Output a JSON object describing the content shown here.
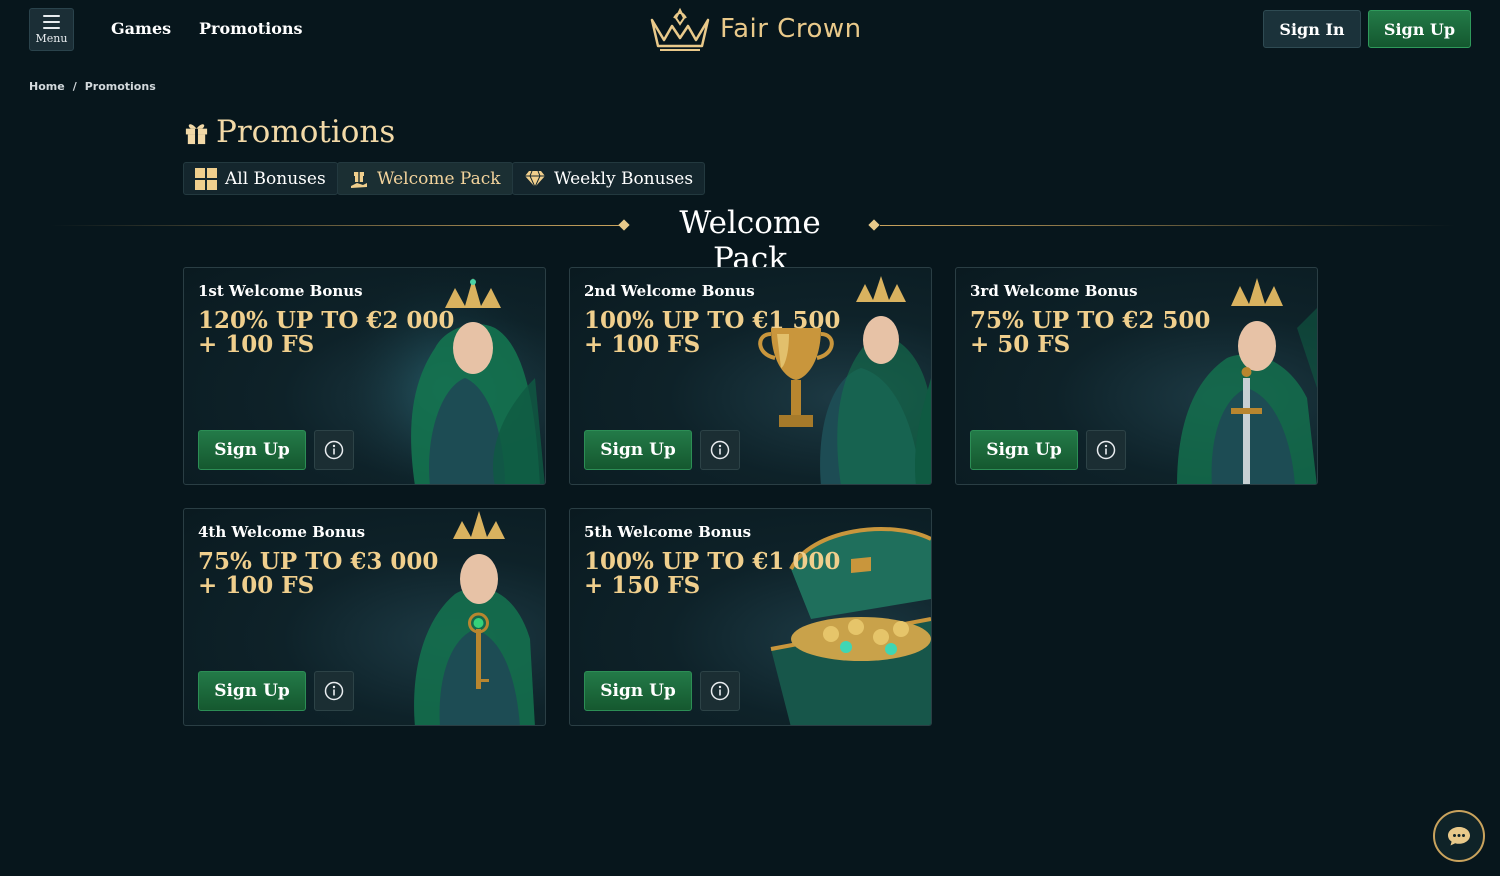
{
  "header": {
    "menu_label": "Menu",
    "nav": [
      "Games",
      "Promotions"
    ],
    "logo_text": "Fair Crown",
    "sign_in": "Sign In",
    "sign_up": "Sign Up"
  },
  "breadcrumb": {
    "home": "Home",
    "separator": "/",
    "current": "Promotions"
  },
  "page_title": "Promotions",
  "tabs": [
    {
      "label": "All Bonuses",
      "icon": "grid-icon",
      "active": false
    },
    {
      "label": "Welcome Pack",
      "icon": "gift-hand-icon",
      "active": true
    },
    {
      "label": "Weekly Bonuses",
      "icon": "diamond-icon",
      "active": false
    }
  ],
  "section_title": "Welcome Pack",
  "cards": [
    {
      "title": "1st Welcome Bonus",
      "amount": "120% UP TO €2 000",
      "spins": "+ 100 FS",
      "button": "Sign Up",
      "art": "elf-queen-icon"
    },
    {
      "title": "2nd Welcome Bonus",
      "amount": "100% UP TO €1 500",
      "spins": "+ 100 FS",
      "button": "Sign Up",
      "art": "elf-queen-trophy-icon"
    },
    {
      "title": "3rd Welcome Bonus",
      "amount": "75% UP TO €2 500",
      "spins": "+ 50 FS",
      "button": "Sign Up",
      "art": "elf-queen-sword-icon"
    },
    {
      "title": "4th Welcome Bonus",
      "amount": "75% UP TO €3 000",
      "spins": "+ 100 FS",
      "button": "Sign Up",
      "art": "elf-queen-key-icon"
    },
    {
      "title": "5th Welcome Bonus",
      "amount": "100% UP TO €1 000",
      "spins": "+ 150 FS",
      "button": "Sign Up",
      "art": "treasure-chest-icon"
    }
  ],
  "colors": {
    "background": "#07161c",
    "gold": "#f0cf8d",
    "green_button": "#1e6e40",
    "accent_line": "#c9a35d"
  }
}
